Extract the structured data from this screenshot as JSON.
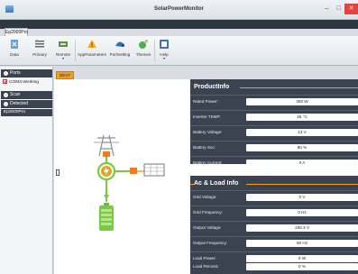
{
  "window": {
    "title": "SolarPowerMonitor",
    "min": "–",
    "max": "□",
    "close": "✕"
  },
  "ribbon": {
    "tab": "Ep2000Pro",
    "buttons": [
      {
        "label": "Data",
        "icon": "data-icon"
      },
      {
        "label": "Primary",
        "icon": "primary-icon"
      },
      {
        "label": "Remote",
        "icon": "remote-icon",
        "arrow": "▾"
      },
      {
        "label": "AppParameters",
        "icon": "warning-icon"
      },
      {
        "label": "PortSetting",
        "icon": "port-setting-icon"
      },
      {
        "label": "Themes",
        "icon": "themes-icon"
      },
      {
        "label": "Help",
        "icon": "help-icon",
        "arrow": "▾"
      }
    ]
  },
  "sidebar": {
    "ports_header": "Ports",
    "port_item": "COM3-Working",
    "scan_header": "Scan",
    "detected_header": "Detected",
    "detected_item": "Ep2000Pro"
  },
  "doc_tab": "DEV7",
  "product_info": {
    "title": "ProductInfo",
    "rows": [
      {
        "label": "Rated Power:",
        "value": "300 W"
      },
      {
        "label": "Inverter TEMP:",
        "value": "26 °C"
      },
      {
        "label": "Battery Voltage:",
        "value": "13 V"
      },
      {
        "label": "Battery Soc:",
        "value": "80 %"
      },
      {
        "label": "Battery Current:",
        "value": "0 A"
      }
    ]
  },
  "ac_load_info": {
    "title": "Ac & Load Info",
    "rows": [
      {
        "label": "Grid Voltage:",
        "value": "0 V"
      },
      {
        "label": "Grid Frequency:",
        "value": "0 Hz"
      },
      {
        "label": "Output Voltage:",
        "value": "230.3 V"
      },
      {
        "label": "Output Frequency:",
        "value": "50 Hz"
      },
      {
        "label": "Load Power:",
        "value": "0 W"
      },
      {
        "label": "Load Percent:",
        "value": "0 %"
      }
    ]
  },
  "colors": {
    "accent": "#f0a020",
    "panel": "#3b4350",
    "green": "#7ac943"
  }
}
